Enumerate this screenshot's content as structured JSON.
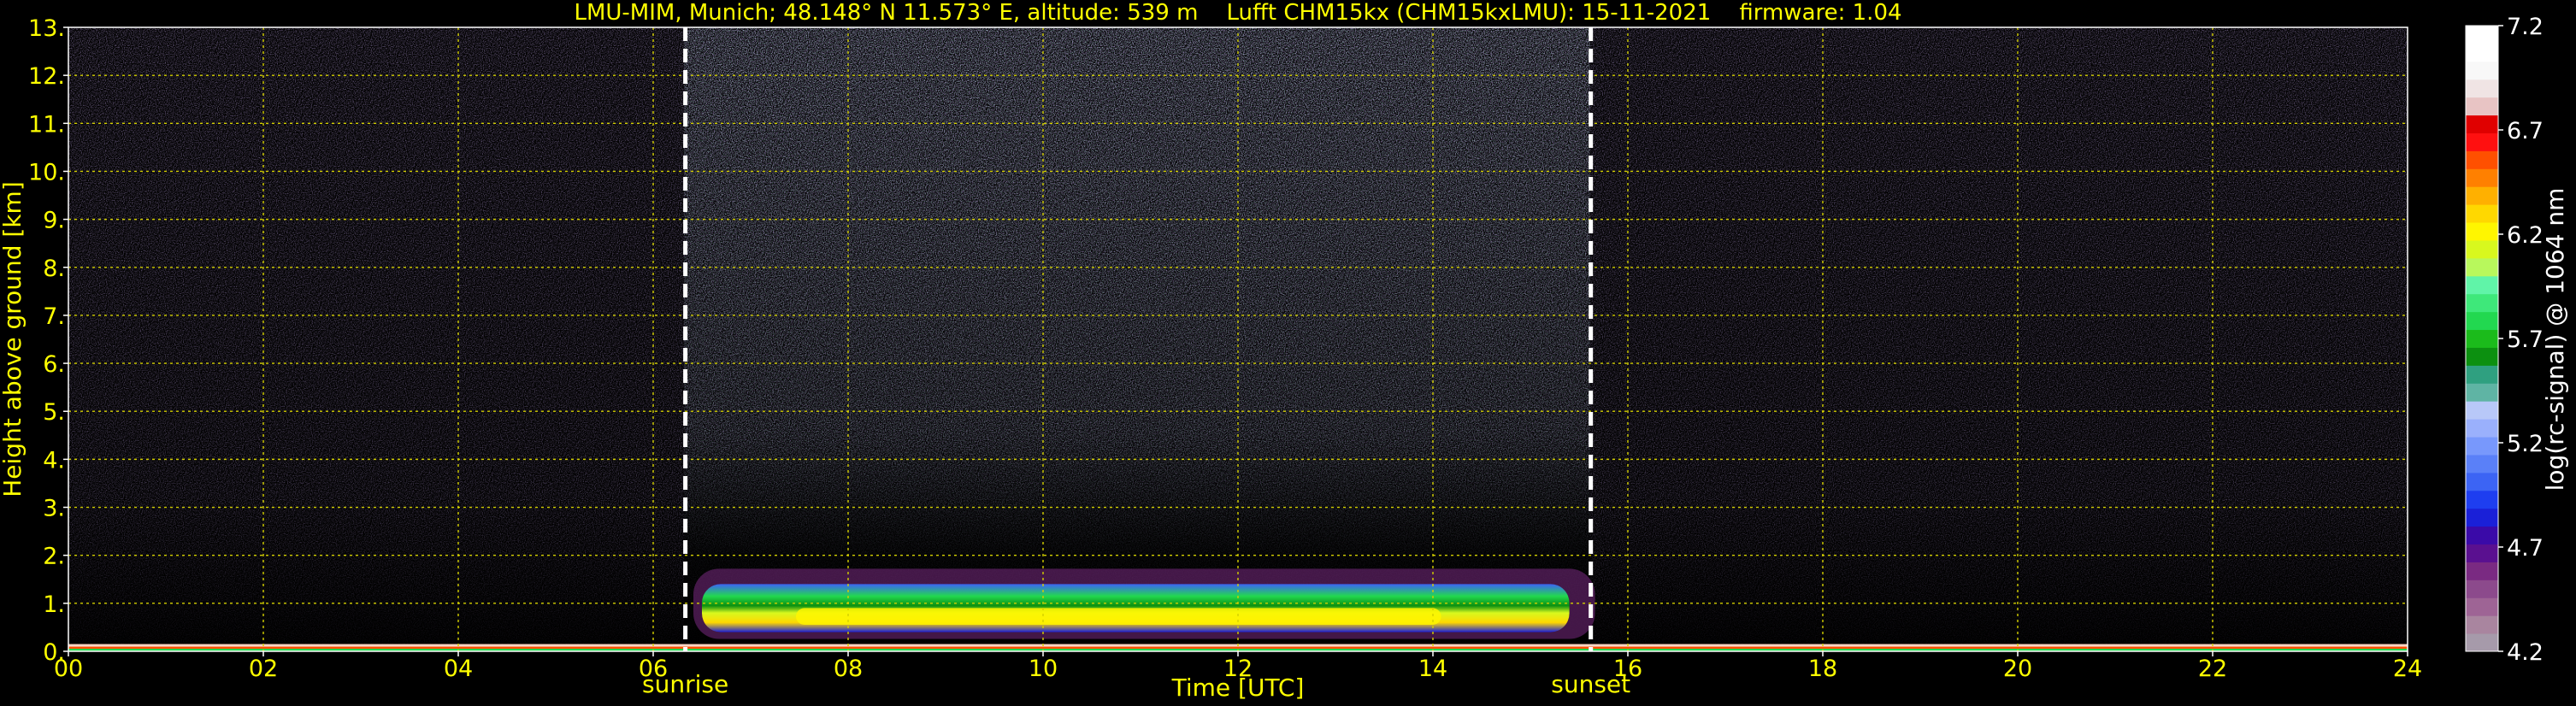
{
  "chart_data": {
    "type": "heatmap",
    "title": "LMU-MIM, Munich; 48.148° N 11.573° E, altitude: 539 m    Lufft CHM15kx (CHM15kxLMU): 15-11-2021    firmware: 1.04",
    "xlabel": "Time [UTC]",
    "ylabel": "Height above ground [km]",
    "xlim": [
      0,
      24
    ],
    "ylim": [
      0,
      13
    ],
    "x_ticks": [
      "00",
      "02",
      "04",
      "06",
      "08",
      "10",
      "12",
      "14",
      "16",
      "18",
      "20",
      "22",
      "24"
    ],
    "y_ticks": [
      "0.",
      "1.",
      "2.",
      "3.",
      "4.",
      "5.",
      "6.",
      "7.",
      "8.",
      "9.",
      "10.",
      "11.",
      "12.",
      "13."
    ],
    "grid": true,
    "markers": [
      {
        "label": "sunrise",
        "x": 6.33
      },
      {
        "label": "sunset",
        "x": 15.62
      }
    ],
    "colorbar": {
      "label": "log(rc-signal) @ 1064 nm",
      "range": [
        4.2,
        7.2
      ],
      "ticks": [
        "7.2",
        "6.7",
        "6.2",
        "5.7",
        "5.2",
        "4.7",
        "4.2"
      ],
      "colors": [
        "#a69aaa",
        "#a9859f",
        "#9e6495",
        "#8c4a8c",
        "#7a2a82",
        "#5a1090",
        "#3a0aa8",
        "#1a20d8",
        "#1e3ef0",
        "#3c64f4",
        "#5a80f8",
        "#7898fc",
        "#9ab0fc",
        "#b8c8f8",
        "#5fb4a4",
        "#2fa080",
        "#0c9010",
        "#1bbb1b",
        "#22d850",
        "#3ee87a",
        "#60f4a8",
        "#b8f85c",
        "#d8f81e",
        "#fff600",
        "#ffd800",
        "#ffb000",
        "#ff8000",
        "#ff5000",
        "#ff1010",
        "#e00000",
        "#e8c4c4",
        "#f0e4e4",
        "#f8f8f8",
        "#ffffff",
        "#ffffff"
      ]
    },
    "features": [
      {
        "label": "aerosol layer",
        "x_start": 6.5,
        "x_end": 15.4,
        "y_bottom": 0.4,
        "y_top": 1.4,
        "peak_value": 5.9
      },
      {
        "label": "near-ground signal",
        "x_start": 0,
        "x_end": 24,
        "y_bottom": 0.0,
        "y_top": 0.15,
        "peak_value": 6.4
      }
    ]
  },
  "colors": {
    "background": "#000000",
    "text": "#ffff00",
    "grid": "#d4d000",
    "marker": "#ffffff",
    "colorbar_text": "#ffffff"
  }
}
